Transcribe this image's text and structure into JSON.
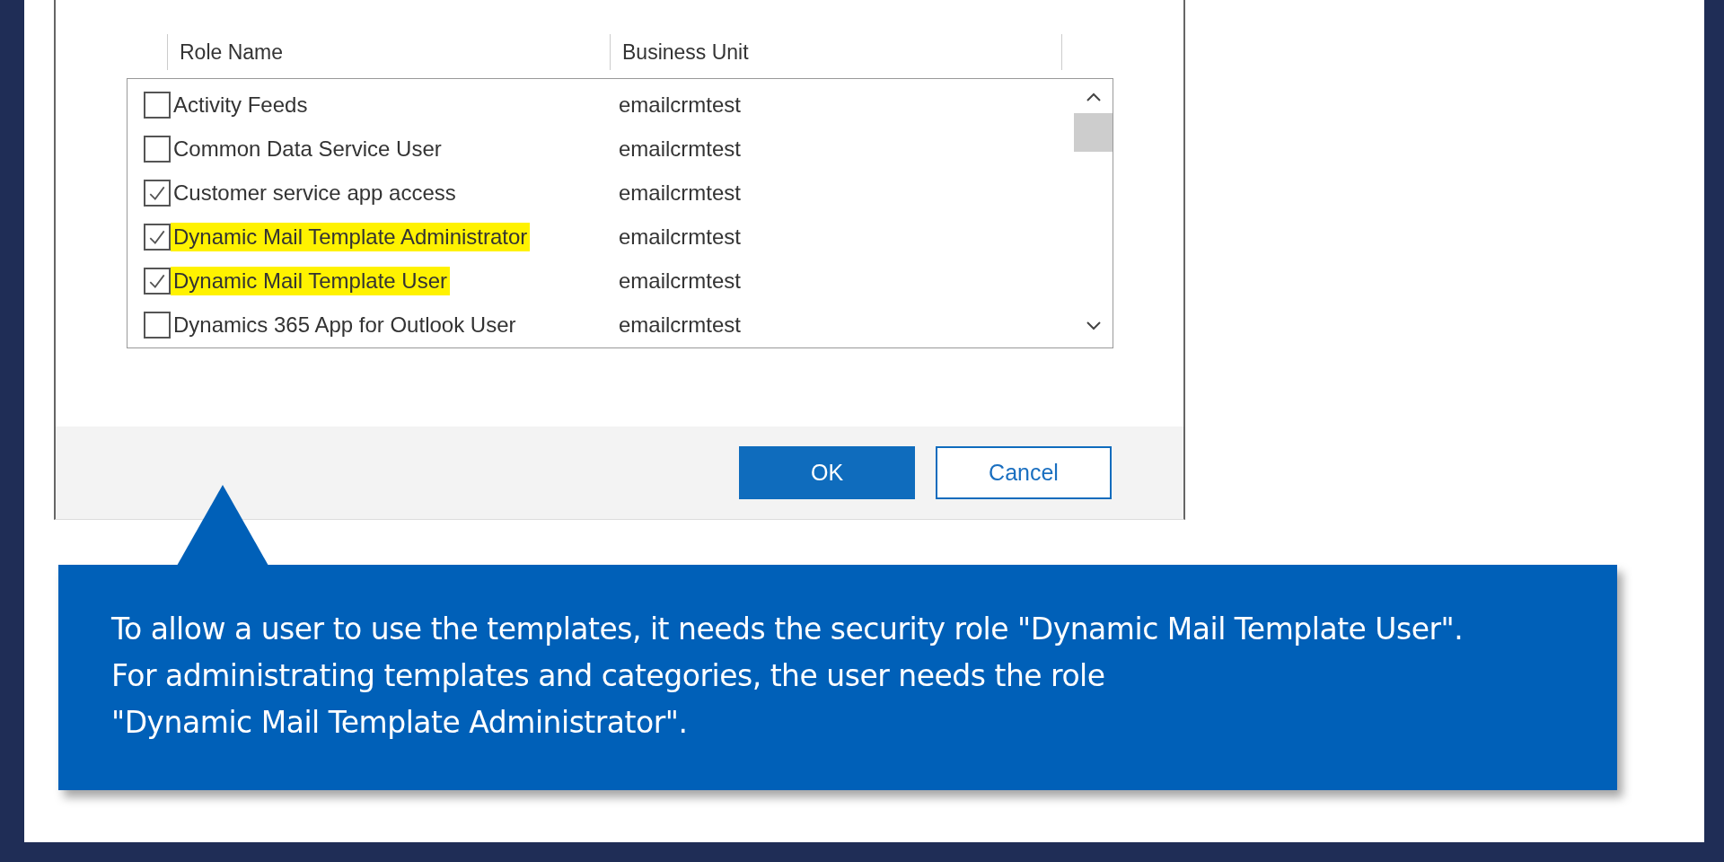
{
  "dialog": {
    "columns": [
      "Role Name",
      "Business Unit"
    ],
    "roles": [
      {
        "name": "Activity Feeds",
        "business_unit": "emailcrmtest",
        "checked": false,
        "highlighted": false
      },
      {
        "name": "Common Data Service User",
        "business_unit": "emailcrmtest",
        "checked": false,
        "highlighted": false
      },
      {
        "name": "Customer service app access",
        "business_unit": "emailcrmtest",
        "checked": true,
        "highlighted": false
      },
      {
        "name": "Dynamic Mail Template Administrator",
        "business_unit": "emailcrmtest",
        "checked": true,
        "highlighted": true
      },
      {
        "name": "Dynamic Mail Template User",
        "business_unit": "emailcrmtest",
        "checked": true,
        "highlighted": true
      },
      {
        "name": "Dynamics 365 App for Outlook User",
        "business_unit": "emailcrmtest",
        "checked": false,
        "highlighted": false
      }
    ],
    "buttons": [
      {
        "label": "OK",
        "kind": "primary"
      },
      {
        "label": "Cancel",
        "kind": "secondary"
      }
    ]
  },
  "callout": {
    "lines": [
      "To allow a user to use the templates, it needs the security role \"Dynamic Mail Template User\".",
      "For administrating templates and categories, the user needs the role",
      "\"Dynamic Mail Template Administrator\"."
    ]
  }
}
